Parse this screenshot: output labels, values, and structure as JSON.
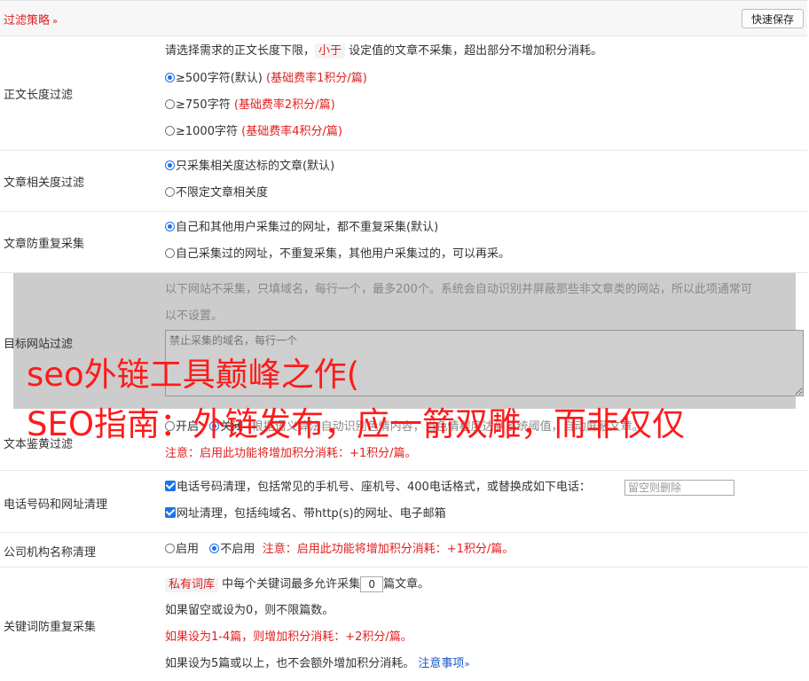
{
  "header": {
    "title": "过滤策略",
    "chevron": "»",
    "save_button": "快速保存"
  },
  "length_filter": {
    "label": "正文长度过滤",
    "desc_prefix": "请选择需求的正文长度下限，",
    "desc_tag": "小于",
    "desc_suffix": "设定值的文章不采集，超出部分不增加积分消耗。",
    "options": [
      {
        "text": "≥500字符(默认)",
        "note": "(基础费率1积分/篇)",
        "selected": true
      },
      {
        "text": "≥750字符",
        "note": "(基础费率2积分/篇)",
        "selected": false
      },
      {
        "text": "≥1000字符",
        "note": "(基础费率4积分/篇)",
        "selected": false
      }
    ]
  },
  "relevance_filter": {
    "label": "文章相关度过滤",
    "options": [
      {
        "text": "只采集相关度达标的文章(默认)",
        "selected": true
      },
      {
        "text": "不限定文章相关度",
        "selected": false
      }
    ]
  },
  "dedupe_filter": {
    "label": "文章防重复采集",
    "options": [
      {
        "text": "自己和其他用户采集过的网址，都不重复采集(默认)",
        "selected": true
      },
      {
        "text": "自己采集过的网址，不重复采集，其他用户采集过的，可以再采。",
        "selected": false
      }
    ]
  },
  "site_filter": {
    "label": "目标网站过滤",
    "desc_line1": "以下网站不采集，只填域名，每行一个，最多200个。系统会自动识别并屏蔽那些非文章类的网站，所以此项通常可",
    "desc_line2": "以不设置。",
    "placeholder": "禁止采集的域名，每行一个"
  },
  "overlay": {
    "line1": "seo外链工具巅峰之作(",
    "line2": "SEO指南：外链发布，应一箭双雕，而非仅仅"
  },
  "porn_filter": {
    "label": "文本鉴黄过滤",
    "on_label": "开启",
    "off_label": "关闭",
    "desc": "(根据语义算法自动识别色情内容，当色情程度达到系统阈值，自动屏蔽文章。",
    "note": "注意：启用此功能将增加积分消耗：+1积分/篇。"
  },
  "contact_clean": {
    "label": "电话号码和网址清理",
    "phone_text": "电话号码清理，包括常见的手机号、座机号、400电话格式，或替换成如下电话：",
    "phone_placeholder": "留空则删除",
    "url_text": "网址清理，包括纯域名、带http(s)的网址、电子邮箱"
  },
  "org_clean": {
    "label": "公司机构名称清理",
    "on_label": "启用",
    "off_label": "不启用",
    "note": "注意：启用此功能将增加积分消耗：+1积分/篇。"
  },
  "keyword_dedupe": {
    "label": "关键词防重复采集",
    "tag": "私有词库",
    "line1_a": "中每个关键词最多允许采集",
    "count": "0",
    "line1_b": "篇文章。",
    "line2": "如果留空或设为0，则不限篇数。",
    "line3": "如果设为1-4篇，则增加积分消耗：+2积分/篇。",
    "line4": "如果设为5篇或以上，也不会额外增加积分消耗。",
    "link": "注意事项",
    "link_chevron": "»"
  }
}
